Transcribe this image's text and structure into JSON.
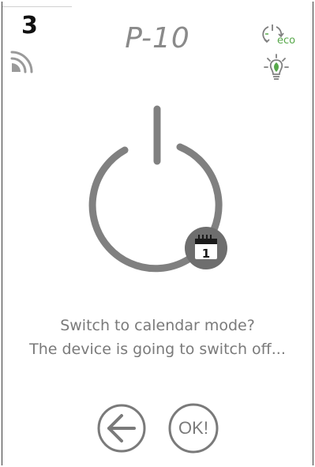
{
  "status": {
    "slot_number": "3",
    "wifi_icon": "wifi-signal-icon"
  },
  "header": {
    "title": "P-10",
    "eco_label": "eco",
    "eco_icon": "eco-cycle-icon",
    "bulb_icon": "leaf-bulb-icon"
  },
  "power": {
    "icon": "power-icon",
    "badge_icon": "calendar-icon",
    "badge_day": "1"
  },
  "prompt": {
    "line1": "Switch to calendar mode?",
    "line2": "The device is going to switch off..."
  },
  "actions": {
    "back_icon": "arrow-left-icon",
    "ok_label": "OK!"
  },
  "colors": {
    "graphic_gray": "#808080",
    "badge_gray": "#6e6e6e",
    "eco_green": "#57a84a"
  }
}
